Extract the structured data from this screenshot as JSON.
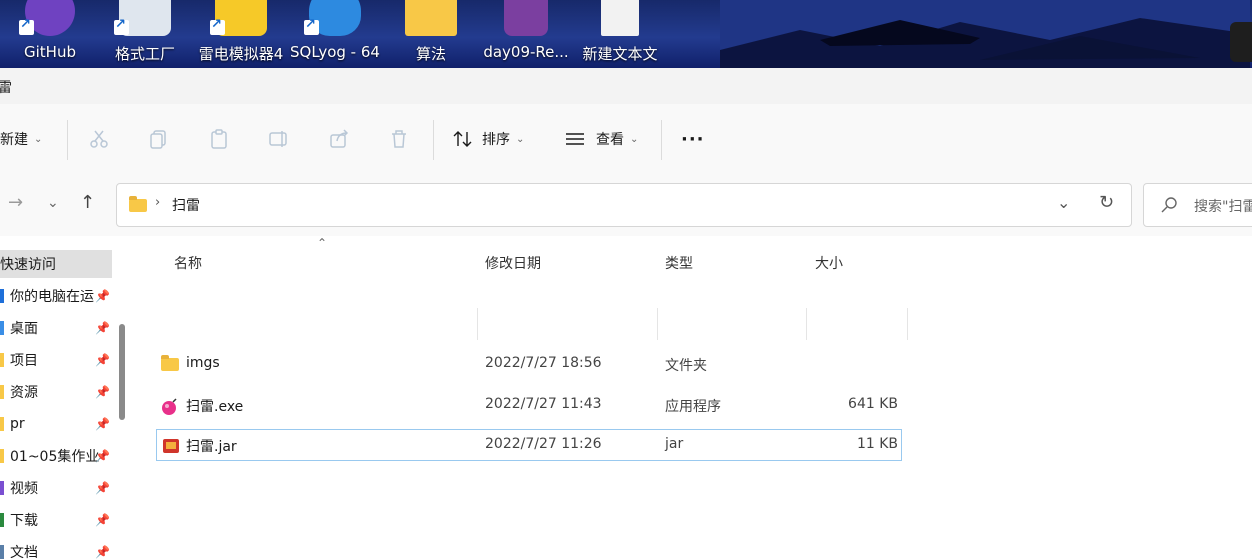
{
  "desktop": {
    "icons": [
      {
        "label": "GitHub",
        "icon": "github-icon",
        "color": "#6f42c1"
      },
      {
        "label": "格式工厂",
        "icon": "format-factory-icon",
        "color": "#dfe6ee"
      },
      {
        "label": "雷电模拟器4",
        "icon": "ldplayer-icon",
        "color": "#f6c928"
      },
      {
        "label": "SQLyog - 64",
        "icon": "sqlyog-dolphin-icon",
        "color": "#2d8ae0"
      },
      {
        "label": "算法",
        "icon": "folder-icon",
        "color": "#f8c847"
      },
      {
        "label": "day09-Re...",
        "icon": "winrar-archive-icon",
        "color": "#7b3fa0"
      },
      {
        "label": "新建文本文",
        "icon": "text-file-icon",
        "color": "#f2f2f2"
      }
    ]
  },
  "window": {
    "title": "雷"
  },
  "toolbar": {
    "new_label": "新建",
    "sort_label": "排序",
    "view_label": "查看",
    "more_label": "···"
  },
  "address": {
    "path_segment": "扫雷",
    "search_placeholder": "搜索\"扫雷"
  },
  "nav_pane": {
    "items": [
      {
        "label": "快速访问",
        "pinned": false,
        "mark": "#f8c847"
      },
      {
        "label": "你的电脑在运",
        "pinned": true,
        "mark": "#1e6fd9"
      },
      {
        "label": "桌面",
        "pinned": true,
        "mark": "#3a8ee6"
      },
      {
        "label": "项目",
        "pinned": true,
        "mark": "#f8c847"
      },
      {
        "label": "资源",
        "pinned": true,
        "mark": "#f8c847"
      },
      {
        "label": "pr",
        "pinned": true,
        "mark": "#f8c847"
      },
      {
        "label": "01~05集作业",
        "pinned": true,
        "mark": "#f8c847"
      },
      {
        "label": "视频",
        "pinned": true,
        "mark": "#7a4fd1"
      },
      {
        "label": "下载",
        "pinned": true,
        "mark": "#2a8a3e"
      },
      {
        "label": "文档",
        "pinned": true,
        "mark": "#5a7fa8"
      }
    ]
  },
  "columns": {
    "name": "名称",
    "date": "修改日期",
    "type": "类型",
    "size": "大小"
  },
  "files": [
    {
      "name": "imgs",
      "date": "2022/7/27 18:56",
      "type": "文件夹",
      "size": "",
      "icon": "folder-icon"
    },
    {
      "name": "扫雷.exe",
      "date": "2022/7/27 11:43",
      "type": "应用程序",
      "size": "641 KB",
      "icon": "bomb-exe-icon"
    },
    {
      "name": "扫雷.jar",
      "date": "2022/7/27 11:26",
      "type": "jar",
      "size": "11 KB",
      "icon": "jar-file-icon"
    }
  ]
}
